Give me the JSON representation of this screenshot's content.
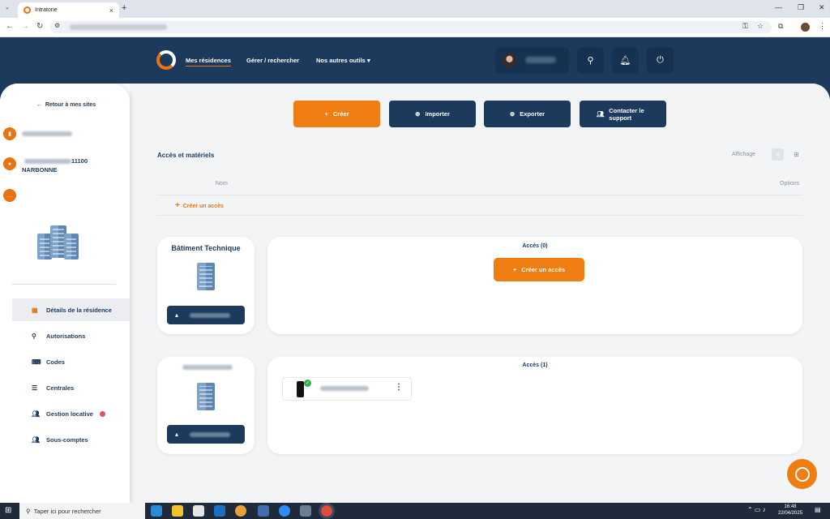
{
  "browser": {
    "tab_title": "Intratone",
    "new_tab": "+",
    "tab_close": "×",
    "min": "—",
    "restore": "❐",
    "close": "✕"
  },
  "header": {
    "nav": [
      "Mes résidences",
      "Gérer / rechercher",
      "Nos autres outils"
    ],
    "dropdown_arrow": "▾"
  },
  "sidebar": {
    "back": "Retour à mes sites",
    "address_suffix": "11100",
    "city": "NARBONNE",
    "menu": [
      {
        "label": "Détails de la résidence",
        "icon": "building-icon"
      },
      {
        "label": "Autorisations",
        "icon": "key-icon"
      },
      {
        "label": "Codes",
        "icon": "keyboard-icon"
      },
      {
        "label": "Centrales",
        "icon": "server-icon"
      },
      {
        "label": "Gestion locative",
        "icon": "users-icon"
      },
      {
        "label": "Sous-comptes",
        "icon": "user-group-icon"
      }
    ]
  },
  "toolbar": {
    "create": "Créer",
    "import": "Importer",
    "export": "Exporter",
    "support": "Contacter le support"
  },
  "access": {
    "title": "Accès et matériels",
    "display_label": "Affichage",
    "col_name": "Nom",
    "col_options": "Options",
    "create_access": "Créer un accès"
  },
  "buildings": [
    {
      "name": "Bâtiment Technique",
      "access_title": "Accès (0)",
      "create_label": "Créer un accès"
    },
    {
      "name": "",
      "access_title": "Accès (1)"
    }
  ],
  "taskbar": {
    "search_placeholder": "Taper ici pour rechercher",
    "time": "16:48",
    "date": "22/04/2025"
  },
  "colors": {
    "navy": "#1c3a5c",
    "orange": "#ef7d11"
  }
}
